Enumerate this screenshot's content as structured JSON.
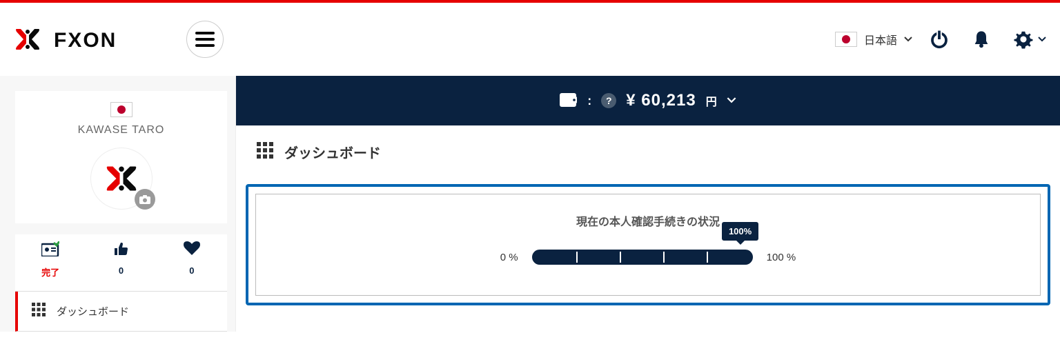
{
  "header": {
    "language_label": "日本語"
  },
  "profile": {
    "name": "KAWASE TARO"
  },
  "stats": {
    "verify_label": "完了",
    "likes_count": "0",
    "favs_count": "0"
  },
  "nav": {
    "dashboard_label": "ダッシュボード"
  },
  "balance": {
    "currency_symbol": "¥",
    "amount": "60,213",
    "unit": "円"
  },
  "page": {
    "title": "ダッシュボード"
  },
  "verification": {
    "title": "現在の本人確認手続きの状況",
    "start_label": "0 %",
    "end_label": "100 %",
    "tooltip": "100%"
  }
}
